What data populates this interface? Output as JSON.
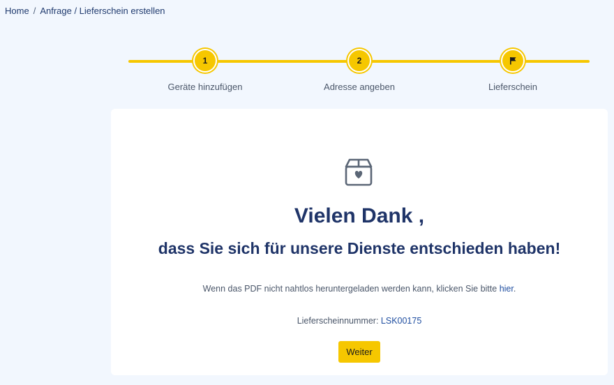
{
  "breadcrumb": {
    "home": "Home",
    "separator": "/",
    "current": "Anfrage / Lieferschein erstellen"
  },
  "stepper": {
    "steps": [
      {
        "number": "1",
        "label": "Geräte hinzufügen"
      },
      {
        "number": "2",
        "label": "Adresse angeben"
      },
      {
        "icon": "flag-icon",
        "label": "Lieferschein"
      }
    ],
    "accent_color": "#f6c700"
  },
  "card": {
    "icon": "box-heart-icon",
    "title": "Vielen Dank ,",
    "subtitle": "dass Sie sich für unsere Dienste entschieden haben!",
    "pdf_note_before": "Wenn das PDF nicht nahtlos heruntergeladen werden kann, klicken Sie bitte ",
    "pdf_link": "hier",
    "pdf_note_after": ".",
    "number_label": "Lieferscheinnummer: ",
    "number_value": "LSK00175",
    "button_label": "Weiter"
  },
  "colors": {
    "background": "#f2f7fe",
    "heading": "#1f3468",
    "link": "#1f4ea0"
  }
}
